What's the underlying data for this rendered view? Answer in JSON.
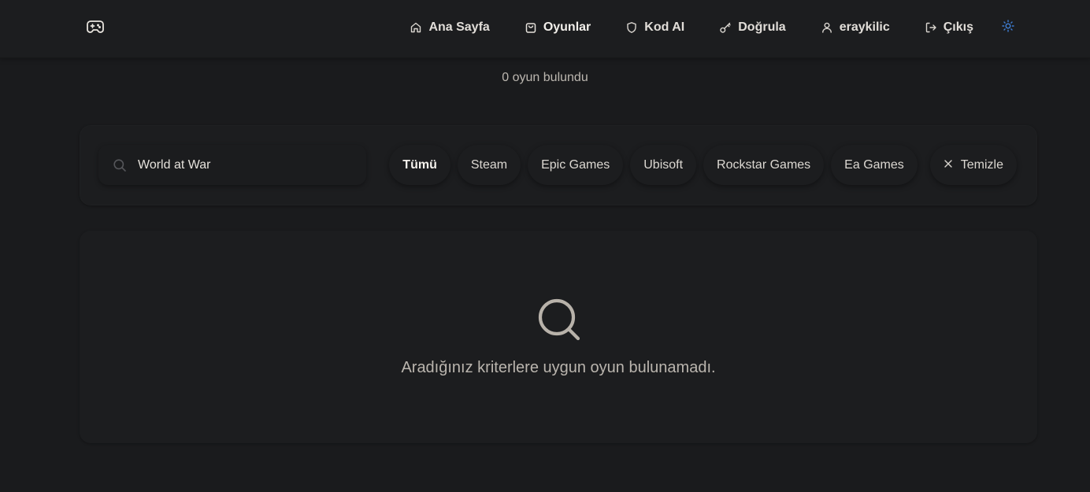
{
  "nav": {
    "logo_icon": "gamepad-icon",
    "items": [
      {
        "label": "Ana Sayfa",
        "icon": "home-icon"
      },
      {
        "label": "Oyunlar",
        "icon": "shopping-bag-icon"
      },
      {
        "label": "Kod AI",
        "icon": "shield-icon"
      },
      {
        "label": "Doğrula",
        "icon": "key-icon"
      },
      {
        "label": "eraykilic",
        "icon": "user-icon"
      },
      {
        "label": "Çıkış",
        "icon": "logout-icon"
      }
    ],
    "active_index": 1,
    "theme_icon": "sun-icon"
  },
  "results": {
    "count_text": "0 oyun bulundu"
  },
  "filters": {
    "search_value": "World at War",
    "chips": [
      "Tümü",
      "Steam",
      "Epic Games",
      "Ubisoft",
      "Rockstar Games",
      "Ea Games"
    ],
    "active_chip": "Tümü",
    "clear_label": "Temizle"
  },
  "empty": {
    "message": "Aradığınız kriterlere uygun oyun bulunamadı."
  },
  "colors": {
    "background": "#1a1b1d",
    "panel": "#1c1d1f",
    "text": "#e1ddd8",
    "muted": "#bab5ae",
    "accent_sun": "#3f7fd6"
  }
}
